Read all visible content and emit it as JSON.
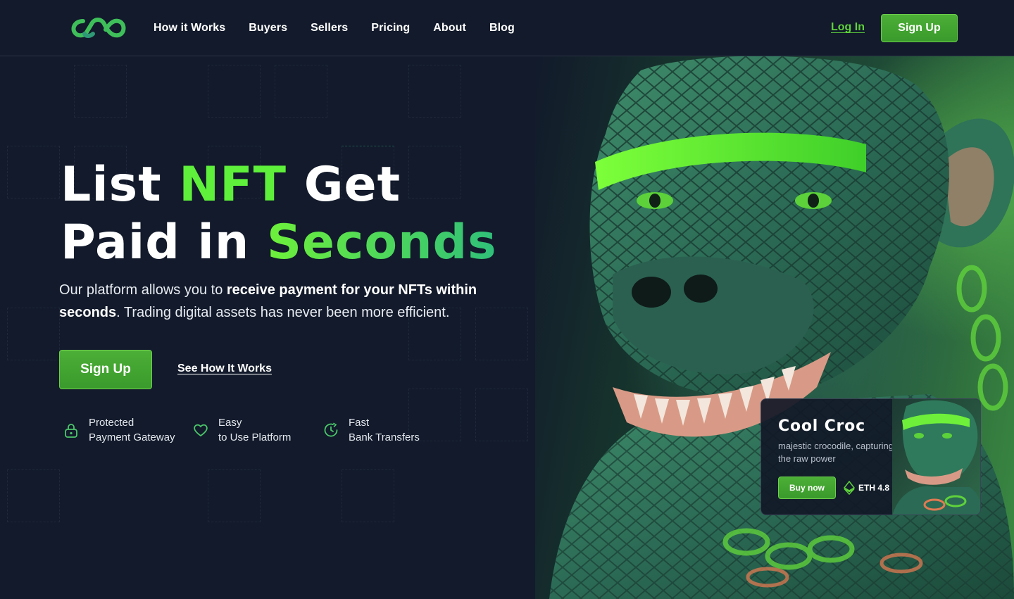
{
  "brand": {
    "logo_icon": "infinity-links-logo",
    "accent": "#5ef03a",
    "accent_dark": "#3a9a2c",
    "background": "#121a2b"
  },
  "nav": {
    "items": [
      {
        "label": "How it Works"
      },
      {
        "label": "Buyers"
      },
      {
        "label": "Sellers"
      },
      {
        "label": "Pricing"
      },
      {
        "label": "About"
      },
      {
        "label": "Blog"
      }
    ],
    "login_label": "Log In",
    "signup_label": "Sign Up"
  },
  "hero": {
    "headline_part1": "List ",
    "headline_highlight1": "NFT",
    "headline_part2": " Get",
    "headline_part3": "Paid in ",
    "headline_highlight2": "Seconds",
    "subtext_part1": "Our platform allows you to ",
    "subtext_bold": "receive payment for your NFTs within seconds",
    "subtext_part2": ". Trading digital assets has never been more efficient.",
    "cta_primary": "Sign Up",
    "cta_secondary": "See How It Works"
  },
  "features": [
    {
      "icon": "lock-icon",
      "line1": "Protected",
      "line2": "Payment Gateway"
    },
    {
      "icon": "heart-icon",
      "line1": "Easy",
      "line2": "to Use Platform"
    },
    {
      "icon": "clock-icon",
      "line1": "Fast",
      "line2": "Bank Transfers"
    }
  ],
  "card": {
    "title": "Cool Croc",
    "description": "majestic crocodile, capturing the raw power",
    "button_label": "Buy now",
    "price": "ETH 4.8",
    "currency_icon": "ethereum-icon"
  }
}
